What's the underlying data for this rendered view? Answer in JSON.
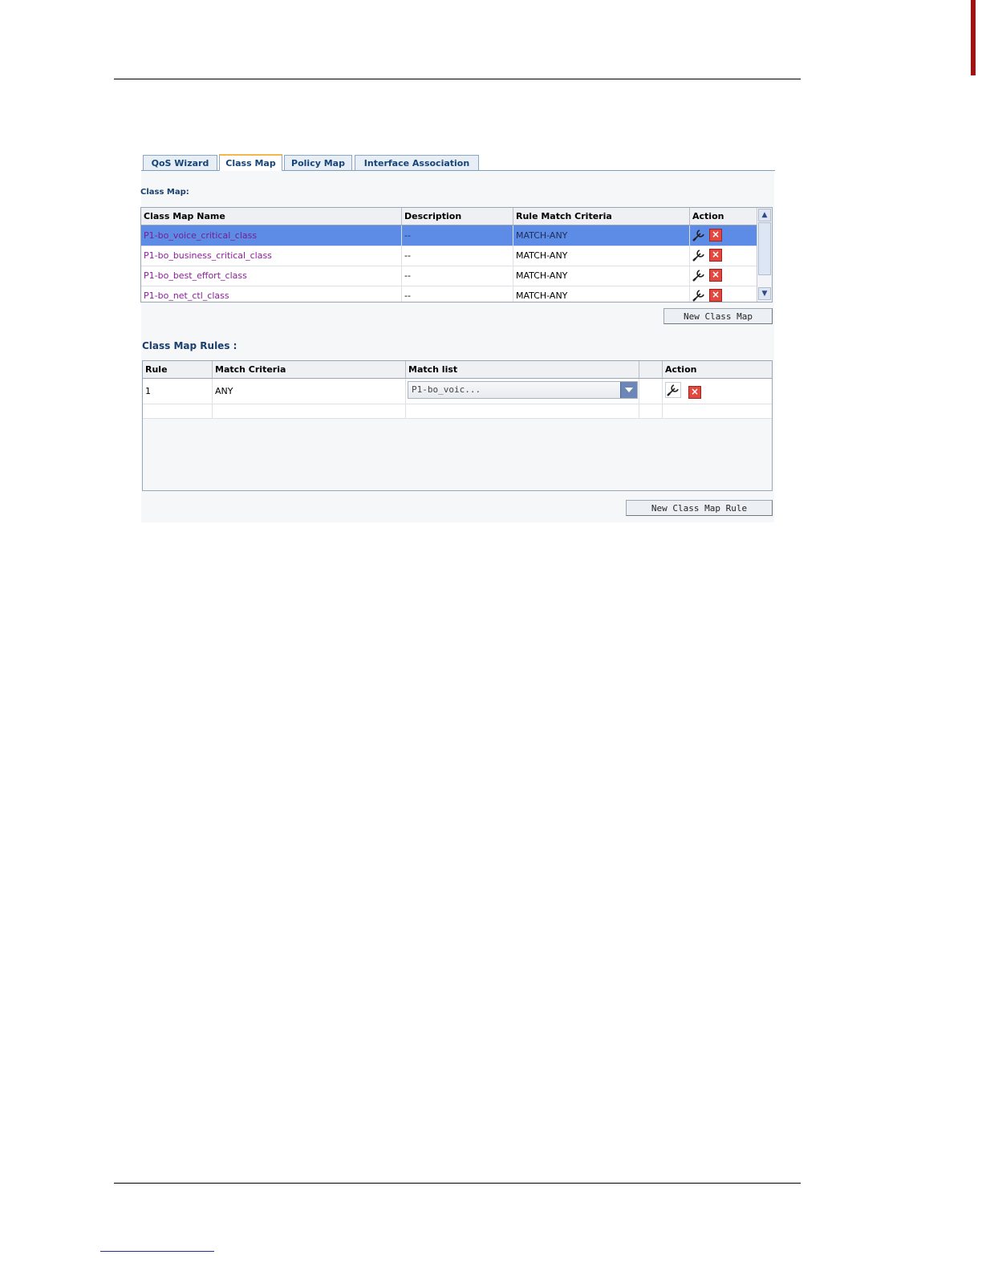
{
  "tabs": [
    {
      "label": "QoS Wizard",
      "active": false
    },
    {
      "label": "Class Map",
      "active": true
    },
    {
      "label": "Policy Map",
      "active": false
    },
    {
      "label": "Interface Association",
      "active": false
    }
  ],
  "class_map": {
    "title": "Class Map:",
    "columns": [
      "Class Map Name",
      "Description",
      "Rule Match Criteria",
      "Action"
    ],
    "rows": [
      {
        "name": "P1-bo_voice_critical_class",
        "description": "--",
        "criteria": "MATCH-ANY",
        "selected": true
      },
      {
        "name": "P1-bo_business_critical_class",
        "description": "--",
        "criteria": "MATCH-ANY",
        "selected": false
      },
      {
        "name": "P1-bo_best_effort_class",
        "description": "--",
        "criteria": "MATCH-ANY",
        "selected": false
      },
      {
        "name": "P1-bo_net_ctl_class",
        "description": "--",
        "criteria": "MATCH-ANY",
        "selected": false
      }
    ],
    "new_button": "New Class Map",
    "icons": {
      "edit": "edit-wrench-icon",
      "delete": "delete-x-icon",
      "scroll_up": "chevron-up-icon",
      "scroll_down": "chevron-down-icon"
    }
  },
  "class_map_rules": {
    "title": "Class Map Rules :",
    "columns": [
      "Rule",
      "Match Criteria",
      "Match list",
      "",
      "Action"
    ],
    "rows": [
      {
        "rule": "1",
        "criteria": "ANY",
        "match_list": "P1-bo_voic..."
      }
    ],
    "new_button": "New Class Map Rule"
  },
  "colors": {
    "accent": "#14457a",
    "selection": "#5c8ce6",
    "link": "#8b1e9a",
    "delete": "#e2483f"
  }
}
